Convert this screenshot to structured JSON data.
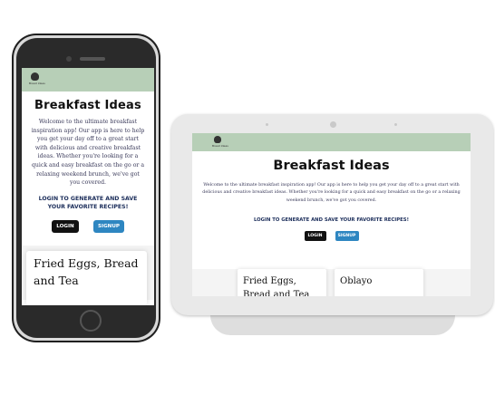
{
  "app": {
    "logo_text": "Bread Ideas",
    "title": "Breakfast Ideas",
    "intro": "Welcome to the ultimate breakfast inspiration app! Our app is here to help you get your day off to a great start with delicious and creative breakfast ideas. Whether you're looking for a quick and easy breakfast on the go or a relaxing weekend brunch, we've got you covered.",
    "cta": "LOGIN TO GENERATE AND SAVE YOUR FAVORITE RECIPES!",
    "login_label": "LOGIN",
    "signup_label": "SIGNUP",
    "cards": [
      {
        "title": "Fried Eggs, Bread and Tea"
      },
      {
        "title": "Oblayo"
      }
    ]
  },
  "colors": {
    "header": "#b7cfb7",
    "login_button": "#111111",
    "signup_button": "#2e86c1",
    "cta_text": "#1b2d5a"
  }
}
